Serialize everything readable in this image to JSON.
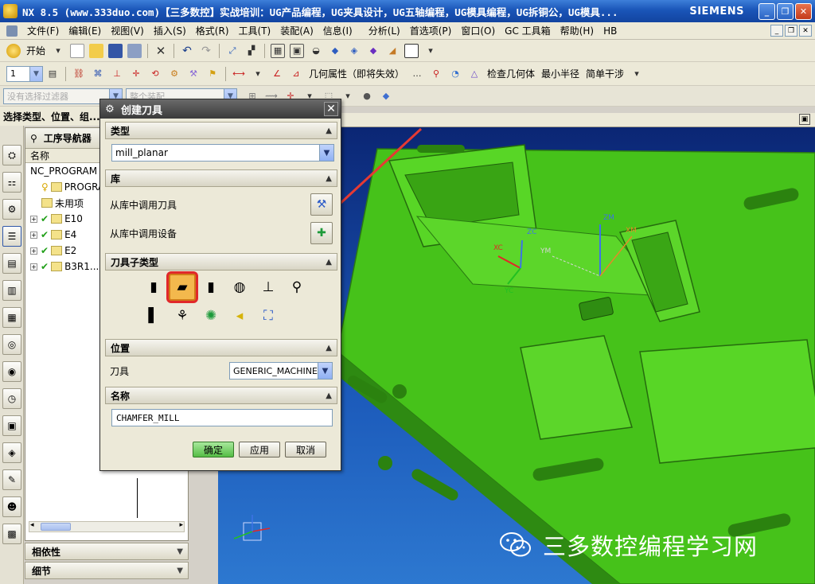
{
  "window": {
    "title": "NX 8.5 (www.333duo.com)【三多数控】实战培训：UG产品编程，UG夹具设计，UG五轴编程，UG模具编程，UG拆铜公，UG模具...",
    "brand": "SIEMENS",
    "minimize": "_",
    "restore": "❐",
    "close": "✕"
  },
  "menubar": {
    "items": [
      "文件(F)",
      "编辑(E)",
      "视图(V)",
      "插入(S)",
      "格式(R)",
      "工具(T)",
      "装配(A)",
      "信息(I)",
      "分析(L)",
      "首选项(P)",
      "窗口(O)",
      "GC 工具箱",
      "帮助(H)",
      "HB"
    ]
  },
  "toolbar1": {
    "start_label": "开始"
  },
  "toolbar2": {
    "layer_value": "1",
    "geom_props_label": "几何属性（即将失效）",
    "check_geom_label": "检查几何体",
    "min_radius_label": "最小半径",
    "simple_interference_label": "简单干涉"
  },
  "toolbar3": {
    "filter_placeholder": "没有选择过滤器",
    "assembly_placeholder": "整个装配"
  },
  "select_row": {
    "label": "选择类型、位置、组..."
  },
  "navigator": {
    "title": "工序导航器",
    "column_name": "名称",
    "rows": [
      {
        "label": "NC_PROGRAM",
        "indent": 0
      },
      {
        "label": "PROGRAM",
        "indent": 1
      },
      {
        "label": "未用项",
        "indent": 1
      },
      {
        "label": "E10",
        "indent": 0
      },
      {
        "label": "E4",
        "indent": 0
      },
      {
        "label": "E2",
        "indent": 0
      },
      {
        "label": "B3R1...",
        "indent": 0
      }
    ],
    "dependencies": "相依性",
    "details": "细节"
  },
  "dialog": {
    "title": "创建刀具",
    "type_group": "类型",
    "type_value": "mill_planar",
    "library_group": "库",
    "lib_tool_label": "从库中调用刀具",
    "lib_device_label": "从库中调用设备",
    "subtype_group": "刀具子类型",
    "position_group": "位置",
    "tool_label": "刀具",
    "tool_value": "GENERIC_MACHINE",
    "name_group": "名称",
    "name_value": "CHAMFER_MILL",
    "ok": "确定",
    "apply": "应用",
    "cancel": "取消"
  },
  "viewport": {
    "axis_labels": [
      "XC",
      "YC",
      "ZC",
      "XM",
      "YM",
      "ZM"
    ]
  },
  "watermark": {
    "text": "三多数控编程学习网"
  },
  "colors": {
    "part_green": "#4ed11f",
    "viewport_top": "#0a2370",
    "viewport_bottom": "#2d78d0",
    "highlight_red": "#e1282a"
  }
}
